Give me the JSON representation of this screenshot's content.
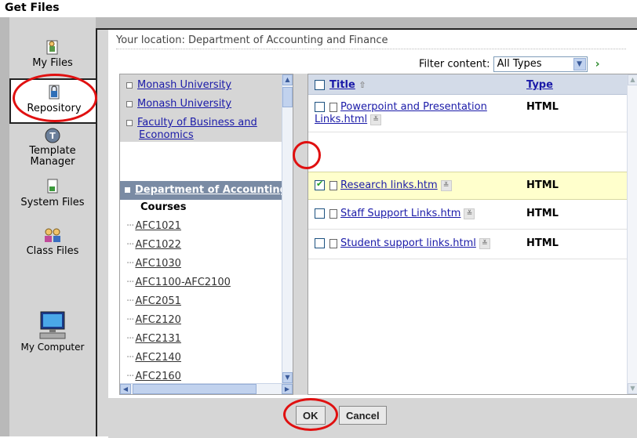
{
  "window": {
    "title": "Get Files"
  },
  "nav": {
    "items": [
      {
        "label": "My Files",
        "icon": "my-files-icon"
      },
      {
        "label": "Repository",
        "icon": "repository-icon",
        "active": true
      },
      {
        "label": "Template Manager",
        "line1": "Template",
        "line2": "Manager",
        "icon": "template-manager-icon"
      },
      {
        "label": "System Files",
        "icon": "system-files-icon"
      },
      {
        "label": "Class Files",
        "icon": "class-files-icon"
      },
      {
        "label": "My Computer",
        "icon": "my-computer-icon"
      }
    ]
  },
  "location": {
    "text": "Your location: Department of Accounting and Finance"
  },
  "filter": {
    "label": "Filter content:",
    "value": "All Types"
  },
  "tree": {
    "nodes": [
      {
        "label": "Monash University"
      },
      {
        "label": "Monash University"
      },
      {
        "label": "Faculty of Business and Economics",
        "line1": "Faculty of Business and",
        "line2": "Economics"
      }
    ],
    "selected": "Department of Accounting and Finance",
    "courses_heading": "Courses",
    "courses": [
      "AFC1021",
      "AFC1022",
      "AFC1030",
      "AFC1100-AFC2100",
      "AFC2051",
      "AFC2120",
      "AFC2131",
      "AFC2140",
      "AFC2160"
    ]
  },
  "files": {
    "header": {
      "title": "Title",
      "type": "Type"
    },
    "rows": [
      {
        "line1": "Powerpoint and Presentation",
        "line2": "Links.html",
        "type": "HTML",
        "checked": false
      },
      {
        "name": "Research links.htm",
        "type": "HTML",
        "checked": true
      },
      {
        "name": "Staff Support Links.htm",
        "type": "HTML",
        "checked": false
      },
      {
        "name": "Student support links.html",
        "type": "HTML",
        "checked": false
      }
    ]
  },
  "buttons": {
    "ok": "OK",
    "cancel": "Cancel"
  },
  "colors": {
    "highlight_ring": "#e01010",
    "selected_row": "#ffffcc",
    "link": "#1a1aa8",
    "tree_selected": "#7a8ba4"
  }
}
